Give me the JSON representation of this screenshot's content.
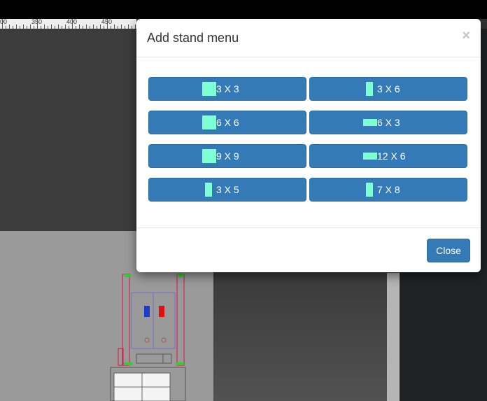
{
  "ruler": {
    "labels": [
      "00",
      "350",
      "400",
      "450"
    ]
  },
  "modal": {
    "title": "Add stand menu",
    "close_symbol": "×",
    "stands": [
      {
        "label": "3 X 3",
        "shape": "square"
      },
      {
        "label": "3 X 6",
        "shape": "tall"
      },
      {
        "label": "6 X 6",
        "shape": "square"
      },
      {
        "label": "6 X 3",
        "shape": "wide"
      },
      {
        "label": "9 X 9",
        "shape": "square"
      },
      {
        "label": "12 X 6",
        "shape": "wide"
      },
      {
        "label": "3 X 5",
        "shape": "tall"
      },
      {
        "label": "7 X 8",
        "shape": "tall"
      }
    ],
    "close_label": "Close"
  },
  "colors": {
    "primary": "#337ab7",
    "stand_shape": "#7fffd4"
  }
}
